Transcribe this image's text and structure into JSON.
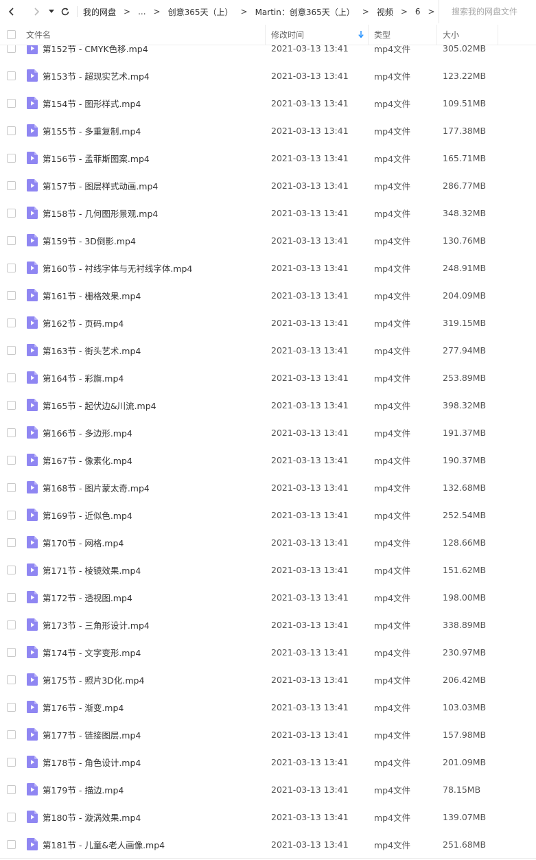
{
  "nav": {
    "back_icon": "chevron-left-icon",
    "forward_icon": "chevron-right-icon",
    "history_icon": "caret-down-icon",
    "refresh_icon": "refresh-icon"
  },
  "breadcrumb": [
    {
      "label": "我的网盘"
    },
    {
      "label": "..."
    },
    {
      "label": "创意365天（上）"
    },
    {
      "label": "Martin：创意365天（上）"
    },
    {
      "label": "视频"
    },
    {
      "label": "6"
    }
  ],
  "search": {
    "placeholder": "搜索我的网盘文件"
  },
  "header": {
    "name": "文件名",
    "time": "修改时间",
    "type": "类型",
    "size": "大小"
  },
  "colors": {
    "file_icon": "#8f86f2",
    "sort_arrow": "#1a8cff"
  },
  "files": [
    {
      "name": "第152节 - CMYK色移.mp4",
      "time": "2021-03-13 13:41",
      "type": "mp4文件",
      "size": "305.02MB"
    },
    {
      "name": "第153节 - 超现实艺术.mp4",
      "time": "2021-03-13 13:41",
      "type": "mp4文件",
      "size": "123.22MB"
    },
    {
      "name": "第154节 - 图形样式.mp4",
      "time": "2021-03-13 13:41",
      "type": "mp4文件",
      "size": "109.51MB"
    },
    {
      "name": "第155节 - 多重复制.mp4",
      "time": "2021-03-13 13:41",
      "type": "mp4文件",
      "size": "177.38MB"
    },
    {
      "name": "第156节 - 孟菲斯图案.mp4",
      "time": "2021-03-13 13:41",
      "type": "mp4文件",
      "size": "165.71MB"
    },
    {
      "name": "第157节 - 图层样式动画.mp4",
      "time": "2021-03-13 13:41",
      "type": "mp4文件",
      "size": "286.77MB"
    },
    {
      "name": "第158节 - 几何图形景观.mp4",
      "time": "2021-03-13 13:41",
      "type": "mp4文件",
      "size": "348.32MB"
    },
    {
      "name": "第159节 - 3D倒影.mp4",
      "time": "2021-03-13 13:41",
      "type": "mp4文件",
      "size": "130.76MB"
    },
    {
      "name": "第160节 - 衬线字体与无衬线字体.mp4",
      "time": "2021-03-13 13:41",
      "type": "mp4文件",
      "size": "248.91MB"
    },
    {
      "name": "第161节 - 栅格效果.mp4",
      "time": "2021-03-13 13:41",
      "type": "mp4文件",
      "size": "204.09MB"
    },
    {
      "name": "第162节 - 页码.mp4",
      "time": "2021-03-13 13:41",
      "type": "mp4文件",
      "size": "319.15MB"
    },
    {
      "name": "第163节 - 街头艺术.mp4",
      "time": "2021-03-13 13:41",
      "type": "mp4文件",
      "size": "277.94MB"
    },
    {
      "name": "第164节 - 彩旗.mp4",
      "time": "2021-03-13 13:41",
      "type": "mp4文件",
      "size": "253.89MB"
    },
    {
      "name": "第165节 - 起伏边&川流.mp4",
      "time": "2021-03-13 13:41",
      "type": "mp4文件",
      "size": "398.32MB"
    },
    {
      "name": "第166节 - 多边形.mp4",
      "time": "2021-03-13 13:41",
      "type": "mp4文件",
      "size": "191.37MB"
    },
    {
      "name": "第167节 - 像素化.mp4",
      "time": "2021-03-13 13:41",
      "type": "mp4文件",
      "size": "190.37MB"
    },
    {
      "name": "第168节 - 图片蒙太奇.mp4",
      "time": "2021-03-13 13:41",
      "type": "mp4文件",
      "size": "132.68MB"
    },
    {
      "name": "第169节 - 近似色.mp4",
      "time": "2021-03-13 13:41",
      "type": "mp4文件",
      "size": "252.54MB"
    },
    {
      "name": "第170节 - 网格.mp4",
      "time": "2021-03-13 13:41",
      "type": "mp4文件",
      "size": "128.66MB"
    },
    {
      "name": "第171节 - 棱镜效果.mp4",
      "time": "2021-03-13 13:41",
      "type": "mp4文件",
      "size": "151.62MB"
    },
    {
      "name": "第172节 - 透视图.mp4",
      "time": "2021-03-13 13:41",
      "type": "mp4文件",
      "size": "198.00MB"
    },
    {
      "name": "第173节 - 三角形设计.mp4",
      "time": "2021-03-13 13:41",
      "type": "mp4文件",
      "size": "338.89MB"
    },
    {
      "name": "第174节 - 文字变形.mp4",
      "time": "2021-03-13 13:41",
      "type": "mp4文件",
      "size": "230.97MB"
    },
    {
      "name": "第175节 - 照片3D化.mp4",
      "time": "2021-03-13 13:41",
      "type": "mp4文件",
      "size": "206.42MB"
    },
    {
      "name": "第176节 - 渐变.mp4",
      "time": "2021-03-13 13:41",
      "type": "mp4文件",
      "size": "103.03MB"
    },
    {
      "name": "第177节 - 链接图层.mp4",
      "time": "2021-03-13 13:41",
      "type": "mp4文件",
      "size": "157.98MB"
    },
    {
      "name": "第178节 - 角色设计.mp4",
      "time": "2021-03-13 13:41",
      "type": "mp4文件",
      "size": "201.09MB"
    },
    {
      "name": "第179节 - 描边.mp4",
      "time": "2021-03-13 13:41",
      "type": "mp4文件",
      "size": "78.15MB"
    },
    {
      "name": "第180节 - 漩涡效果.mp4",
      "time": "2021-03-13 13:41",
      "type": "mp4文件",
      "size": "139.07MB"
    },
    {
      "name": "第181节 - 儿童&老人画像.mp4",
      "time": "2021-03-13 13:41",
      "type": "mp4文件",
      "size": "251.68MB"
    }
  ]
}
